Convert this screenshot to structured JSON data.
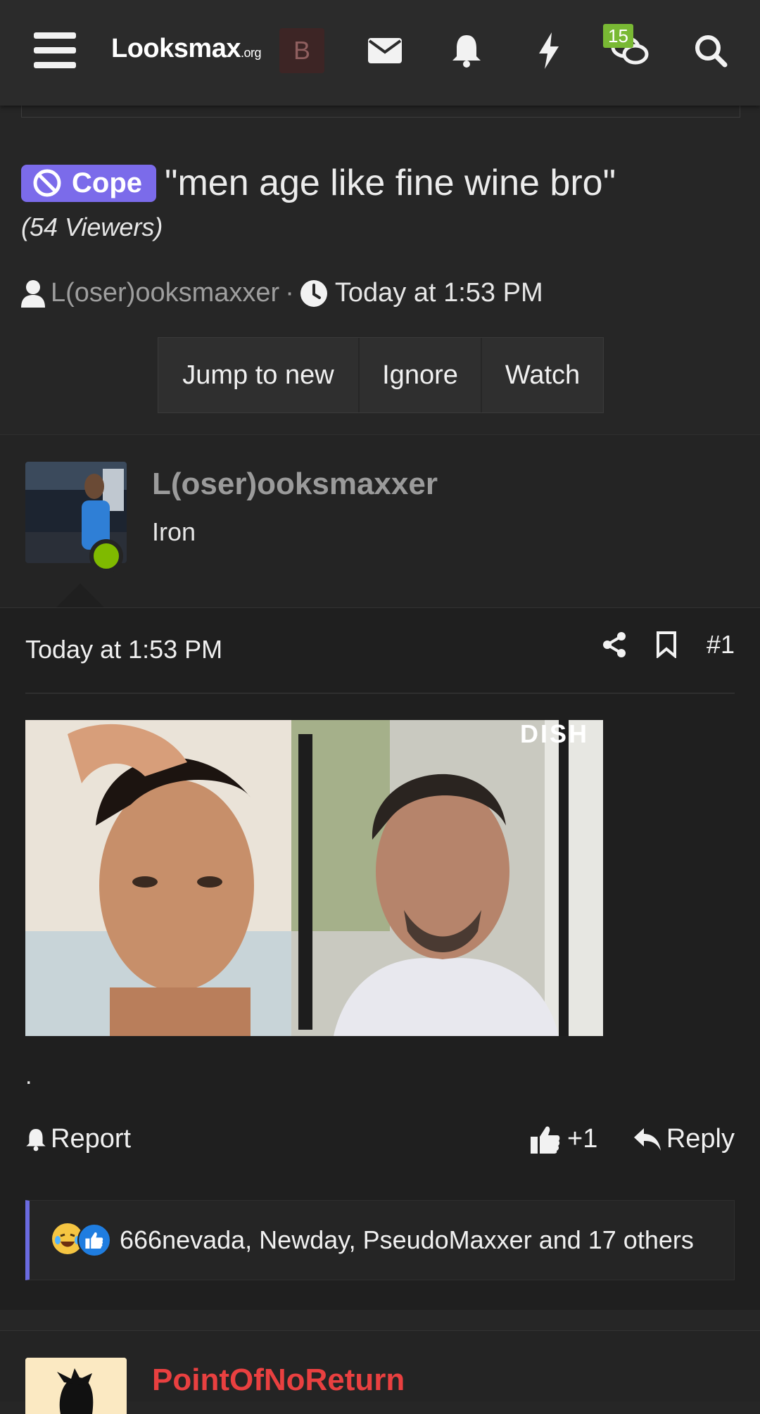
{
  "header": {
    "logo_main": "Looksmax",
    "logo_suffix": ".org",
    "avatar_letter": "B",
    "icons": [
      "menu-icon",
      "envelope-icon",
      "bell-icon",
      "bolt-icon",
      "chat-bubbles-icon",
      "search-icon"
    ],
    "chat_badge": "15"
  },
  "thread": {
    "prefix_label": "Cope",
    "title": "\"men age like fine wine bro\"",
    "viewers": "(54 Viewers)",
    "author": "L(oser)ooksmaxxer",
    "separator": "·",
    "time": "Today at 1:53 PM",
    "buttons": {
      "jump": "Jump to new",
      "ignore": "Ignore",
      "watch": "Watch"
    }
  },
  "post": {
    "username": "L(oser)ooksmaxxer",
    "user_title": "Iron",
    "date": "Today at 1:53 PM",
    "number": "#1",
    "image_caption": "DISH",
    "text": ".",
    "report_label": "Report",
    "like_label": "+1",
    "reply_label": "Reply",
    "reactions_text": "666nevada, Newday, PseudoMaxxer and 17 others",
    "colors": {
      "online": "#7fba00",
      "prefix": "#7b6bea",
      "reaction_bar": "#6b6be0"
    }
  },
  "next_post": {
    "username": "PointOfNoReturn",
    "username_color": "#e94040"
  }
}
